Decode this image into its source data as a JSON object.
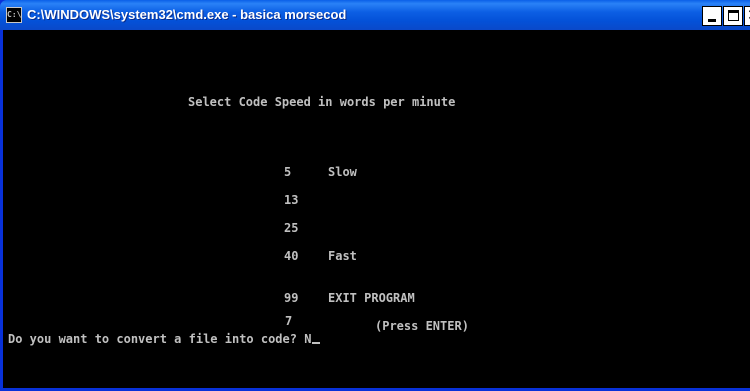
{
  "window": {
    "title": "C:\\WINDOWS\\system32\\cmd.exe - basica morsecod",
    "icon": "cmd-icon",
    "icon_text": "C:\\",
    "accent": "#0a5fe8"
  },
  "console": {
    "heading": "Select Code Speed in words per minute",
    "options": [
      {
        "value": "5",
        "label": "Slow"
      },
      {
        "value": "13",
        "label": ""
      },
      {
        "value": "25",
        "label": ""
      },
      {
        "value": "40",
        "label": "Fast"
      },
      {
        "value": "99",
        "label": "EXIT PROGRAM"
      }
    ],
    "input_value": "7",
    "input_hint": "(Press ENTER)",
    "prompt": "Do you want to convert a file into code? N",
    "text_color": "#c0c0c0",
    "background_color": "#000000"
  }
}
